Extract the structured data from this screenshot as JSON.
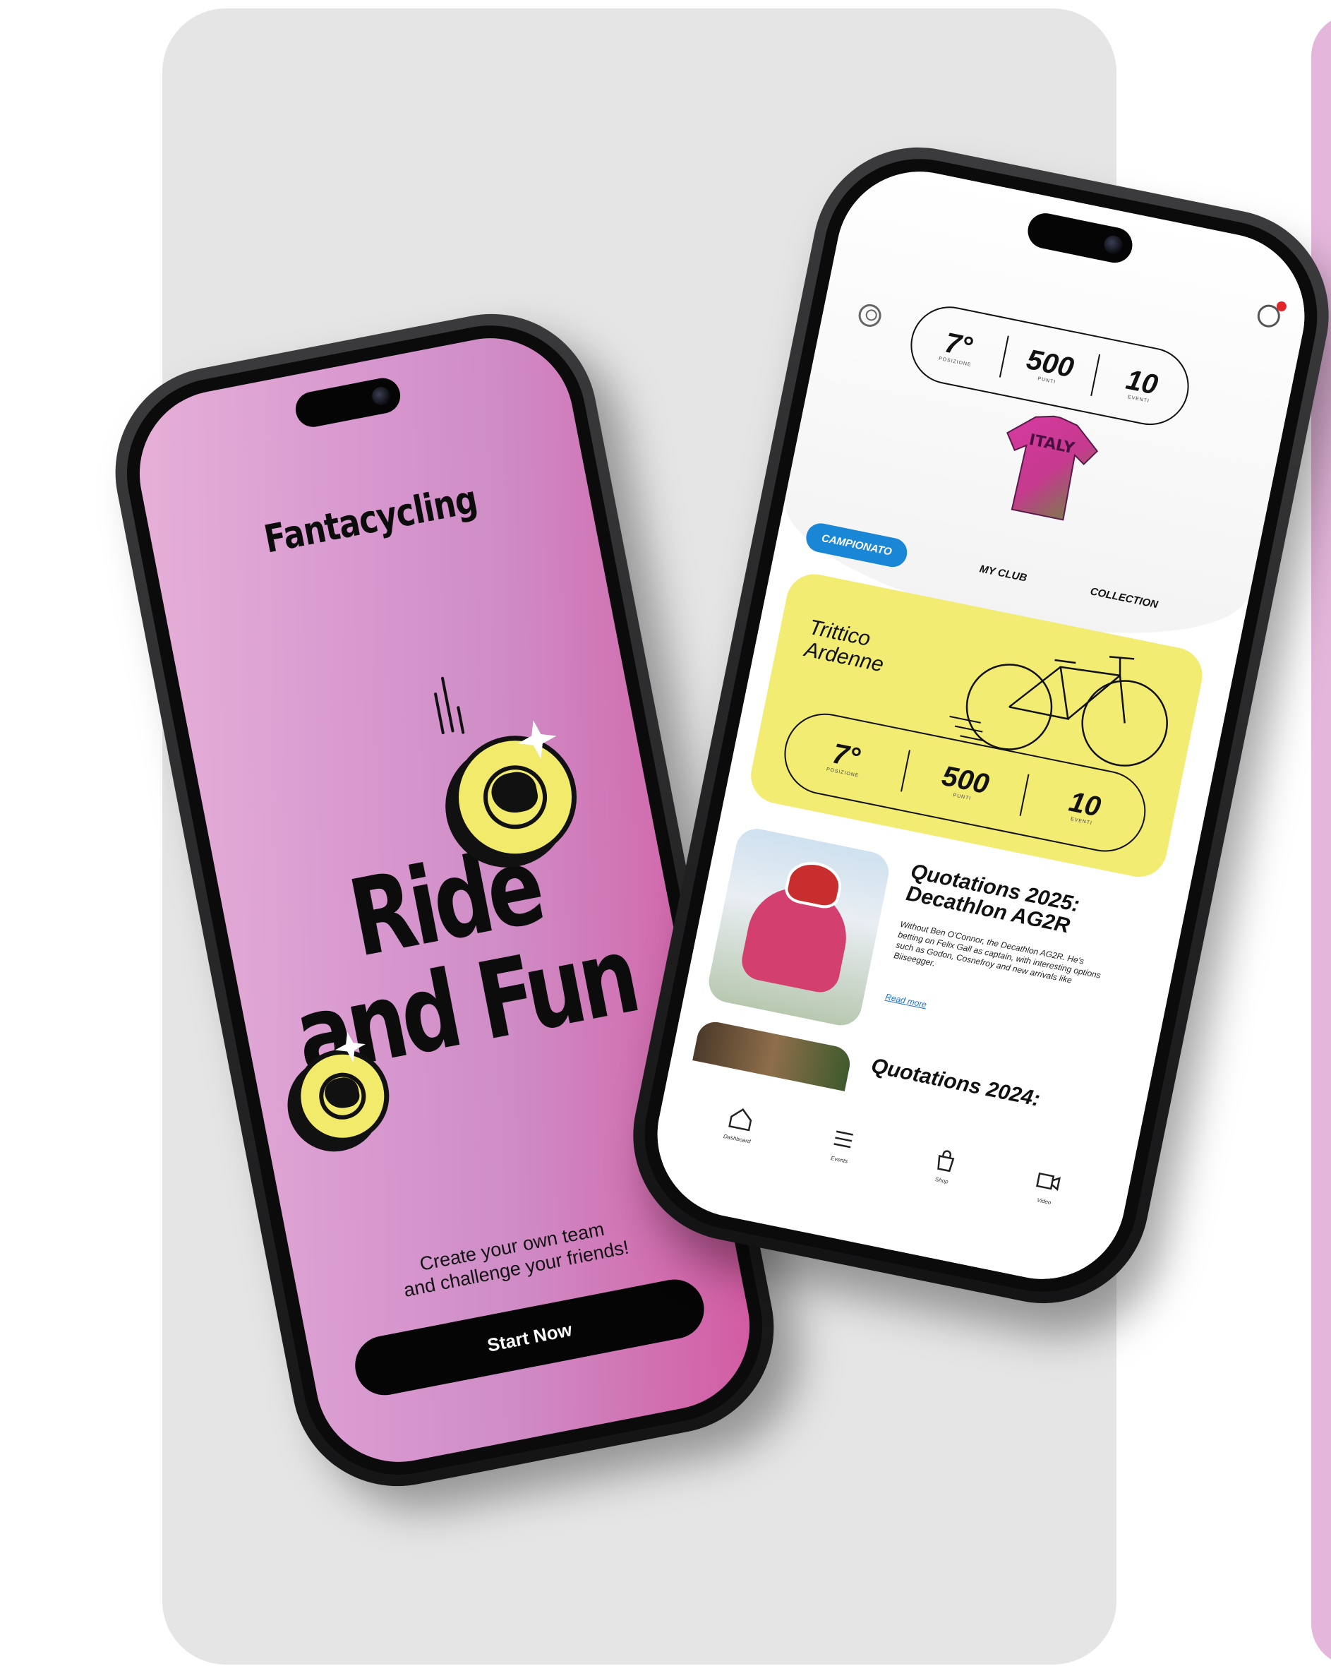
{
  "left_screen": {
    "brand": "Fantacycling",
    "hero": [
      "Ride",
      "and Fun"
    ],
    "tagline": [
      "Create your own team",
      "and challenge your friends!"
    ],
    "cta_label": "Start Now"
  },
  "right_screen": {
    "header_stats": [
      {
        "value": "7°",
        "label": "POSIZIONE"
      },
      {
        "value": "500",
        "label": "PUNTI"
      },
      {
        "value": "10",
        "label": "EVENTI"
      }
    ],
    "jersey_text": "ITALY",
    "tabs": [
      "CAMPIONATO",
      "MY CLUB",
      "COLLECTION"
    ],
    "event": {
      "title": [
        "Trittico",
        "Ardenne"
      ],
      "stats": [
        {
          "value": "7°",
          "label": "POSIZIONE"
        },
        {
          "value": "500",
          "label": "PUNTI"
        },
        {
          "value": "10",
          "label": "EVENTI"
        }
      ]
    },
    "news": [
      {
        "title": "Quotations 2025: Decathlon AG2R",
        "body": "Without Ben O'Connor, the Decathlon AG2R. He's betting on Felix Gall as captain, with interesting options such as Godon, Cosnefroy and new arrivals like Biiseegger.",
        "link": "Read more"
      },
      {
        "title": "Quotations 2024:"
      }
    ],
    "nav": [
      {
        "icon": "home-icon",
        "label": "Dashboard"
      },
      {
        "icon": "menu-icon",
        "label": "Events"
      },
      {
        "icon": "shop-icon",
        "label": "Shop"
      },
      {
        "icon": "video-icon",
        "label": "Video"
      }
    ]
  },
  "colors": {
    "pink_gradient_start": "#e6b1d8",
    "pink_gradient_end": "#d35aa1",
    "yellow": "#f1ea6a",
    "blue_tab": "#1a87d6",
    "background": "#e5e5e5"
  }
}
